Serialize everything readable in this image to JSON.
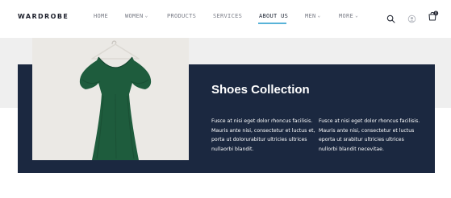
{
  "header": {
    "logo": "WARDROBE",
    "nav": [
      {
        "label": "HOME"
      },
      {
        "label": "WOMEN"
      },
      {
        "label": "PRODUCTS"
      },
      {
        "label": "SERVICES"
      },
      {
        "label": "ABOUT US",
        "active": true
      },
      {
        "label": "MEN"
      },
      {
        "label": "MORE"
      }
    ],
    "cart_count": "0"
  },
  "hero": {
    "title": "Shoes Collection",
    "text_left": "Fusce at nisi eget dolor rhoncus facilisis. Mauris ante nisi, consectetur et luctus et, porta ut dolorurabitur ultricies ultrices nullaorbi blandit.",
    "text_right": "Fusce at nisi eget dolor rhoncus facilisis. Mauris ante nisi, consectetur et luctus eporta ut srabitur ultricies ultrices nullorbi blandit necevitae."
  },
  "colors": {
    "navy": "#1b2840",
    "accent": "#58b3d8",
    "dress": "#1e5c3d"
  },
  "icons": [
    "search-icon",
    "user-icon",
    "cart-icon",
    "chevron-down-icon"
  ]
}
